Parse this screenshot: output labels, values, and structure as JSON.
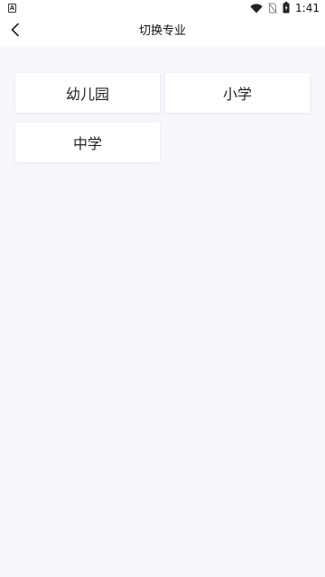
{
  "status_bar": {
    "left_icon_letter": "A",
    "time": "1:41",
    "icons": [
      "wifi-icon",
      "no-sim-icon",
      "battery-icon"
    ]
  },
  "header": {
    "title": "切换专业",
    "back_icon": "chevron-left-icon"
  },
  "options": [
    {
      "label": "幼儿园"
    },
    {
      "label": "小学"
    },
    {
      "label": "中学"
    }
  ],
  "colors": {
    "page_background": "#f7f8fc",
    "card_background": "#ffffff",
    "text": "#222222"
  }
}
